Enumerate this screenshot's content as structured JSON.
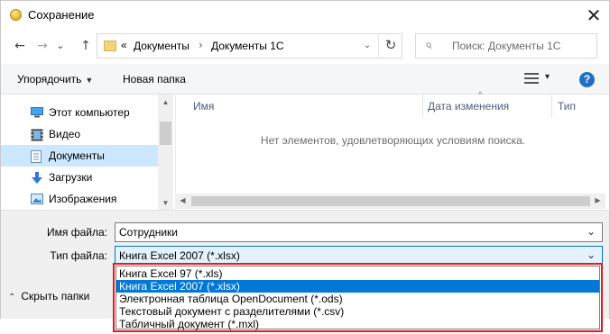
{
  "window": {
    "title": "Сохранение",
    "close_glyph": "✕"
  },
  "nav": {
    "back_glyph": "←",
    "forward_glyph": "→",
    "recent_glyph": "⌄",
    "up_glyph": "↑",
    "breadcrumb_overflow": "«",
    "breadcrumb": [
      "Документы",
      "Документы 1С"
    ],
    "breadcrumb_sep": "›",
    "address_dropdown_glyph": "⌄",
    "refresh_glyph": "↻",
    "search_placeholder": "Поиск: Документы 1С",
    "search_glyph": "⌕"
  },
  "toolbar": {
    "organize_label": "Упорядочить",
    "new_folder_label": "Новая папка",
    "view_dropdown_glyph": "▾",
    "help_glyph": "?"
  },
  "sidebar": {
    "items": [
      {
        "label": "Этот компьютер",
        "icon": "computer-icon",
        "selected": false
      },
      {
        "label": "Видео",
        "icon": "video-icon",
        "selected": false
      },
      {
        "label": "Документы",
        "icon": "documents-icon",
        "selected": true
      },
      {
        "label": "Загрузки",
        "icon": "downloads-icon",
        "selected": false
      },
      {
        "label": "Изображения",
        "icon": "pictures-icon",
        "selected": false
      }
    ],
    "scroll_up_glyph": "▲",
    "scroll_down_glyph": "▼"
  },
  "file_list": {
    "columns": [
      "Имя",
      "Дата изменения",
      "Тип"
    ],
    "empty_message": "Нет элементов, удовлетворяющих условиям поиска.",
    "scroll_left_glyph": "◀",
    "scroll_right_glyph": "▶",
    "sort_glyph": "^"
  },
  "form": {
    "filename_label": "Имя файла:",
    "filename_value": "Сотрудники",
    "filetype_label": "Тип файла:",
    "filetype_value": "Книга Excel 2007 (*.xlsx)",
    "dropdown_glyph": "⌄"
  },
  "hide_folders_label": "Скрыть папки",
  "hide_folders_glyph": "⌃",
  "filetype_options": [
    {
      "label": "Книга Excel 97 (*.xls)",
      "selected": false
    },
    {
      "label": "Книга Excel 2007 (*.xlsx)",
      "selected": true
    },
    {
      "label": "Электронная таблица OpenDocument (*.ods)",
      "selected": false
    },
    {
      "label": "Текстовый документ с разделителями (*.csv)",
      "selected": false
    },
    {
      "label": "Табличный документ (*.mxl)",
      "selected": false
    }
  ],
  "colors": {
    "accent": "#0078d7",
    "highlight_border": "#d91f26",
    "selected_tree": "#cce8ff"
  }
}
